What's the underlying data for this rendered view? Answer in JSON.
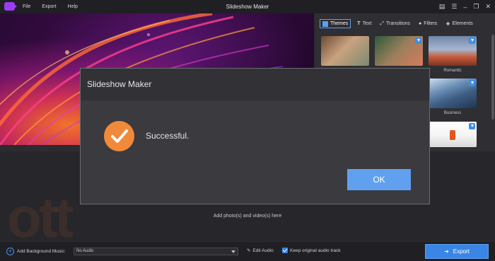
{
  "titlebar": {
    "title": "Slideshow Maker",
    "menu": [
      "File",
      "Export",
      "Help"
    ]
  },
  "right_panel": {
    "tabs": [
      "Themes",
      "Text",
      "Transitions",
      "Filters",
      "Elements"
    ],
    "thumb_labels": [
      "Romantic",
      "Business"
    ]
  },
  "timeline": {
    "add_hint": "Add photo(s) and video(s) here"
  },
  "bottom": {
    "bg_music_label": "Add Background Music:",
    "audio_value": "No Audio",
    "edit_audio": "Edit Audio",
    "keep_audio": "Keep original audio track",
    "export": "Export"
  },
  "dialog": {
    "title": "Slideshow Maker",
    "message": "Successful.",
    "ok": "OK"
  },
  "watermark": "ott",
  "colors": {
    "accent": "#3a86e6",
    "success": "#f08a3a"
  }
}
